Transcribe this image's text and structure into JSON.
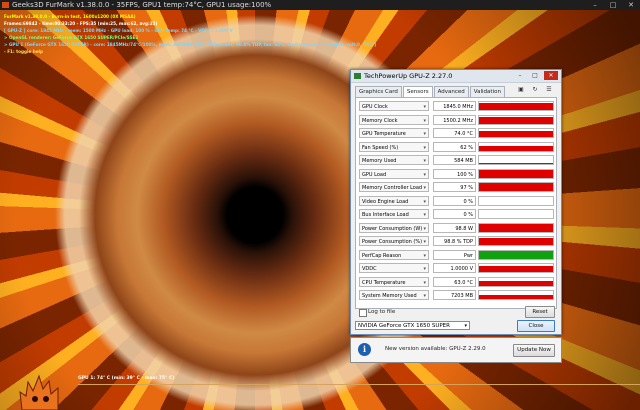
{
  "window": {
    "title": "Geeks3D FurMark v1.38.0.0 - 35FPS, GPU1 temp:74°C, GPU1 usage:100%",
    "minimize": "–",
    "maximize": "□",
    "close": "✕"
  },
  "osd": [
    "FurMark v1.38.0.0 - Burn-in test, 1600x1200 (0X MSAA)",
    "Frames:69842 - time:00:33:20 - FPS:35 (min:25, max:62, avg:35)",
    "[ GPU-Z ] core: 1845 MHz - mem: 1500 MHz - GPU load: 100 % - GPU temp: 74 °C - VDDC: 1.000 V",
    "> OpenGL renderer: GeForce GTX 1650 SUPER/PCIe/SSE2",
    "> GPU 1 (GeForce GTX 1650 SUPER) - core: 1845MHz/74°C/100%, mem: 6000MHz/9%, GPU power: 98.8% TDP, fan: 62%, limits:[power:1, temp:0, volt:0, OV:0]",
    "- F1: toggle help"
  ],
  "gpuz": {
    "title": "TechPowerUp GPU-Z 2.27.0",
    "window_buttons": [
      "–",
      "□",
      "✕"
    ],
    "tabs": [
      {
        "label": "Graphics Card",
        "active": false
      },
      {
        "label": "Sensors",
        "active": true
      },
      {
        "label": "Advanced",
        "active": false
      },
      {
        "label": "Validation",
        "active": false
      }
    ],
    "toolbar_icons": [
      "camera-icon",
      "refresh-icon",
      "menu-icon"
    ],
    "sensors": [
      {
        "label": "GPU Clock",
        "value": "1845.0 MHz",
        "fill": 0.85,
        "color": "#e00000"
      },
      {
        "label": "Memory Clock",
        "value": "1500.2 MHz",
        "fill": 0.85,
        "color": "#e00000"
      },
      {
        "label": "GPU Temperature",
        "value": "74.0 °C",
        "fill": 0.75,
        "color": "#e00000"
      },
      {
        "label": "Fan Speed (%)",
        "value": "62 %",
        "fill": 0.62,
        "color": "#e00000"
      },
      {
        "label": "Memory Used",
        "value": "584 MB",
        "fill": 0.12,
        "color": "#e00000"
      },
      {
        "label": "GPU Load",
        "value": "100 %",
        "fill": 1.0,
        "color": "#e00000"
      },
      {
        "label": "Memory Controller Load",
        "value": "97 %",
        "fill": 0.97,
        "color": "#e00000"
      },
      {
        "label": "Video Engine Load",
        "value": "0 %",
        "fill": 0.0,
        "color": "#e00000"
      },
      {
        "label": "Bus Interface Load",
        "value": "0 %",
        "fill": 0.0,
        "color": "#e00000"
      },
      {
        "label": "Power Consumption (W)",
        "value": "98.8 W",
        "fill": 0.9,
        "color": "#e00000"
      },
      {
        "label": "Power Consumption (%)",
        "value": "98.8 % TDP",
        "fill": 0.9,
        "color": "#e00000"
      },
      {
        "label": "PerfCap Reason",
        "value": "Pwr",
        "fill": 1.0,
        "color": "#10a010"
      },
      {
        "label": "VDDC",
        "value": "1.0000 V",
        "fill": 0.7,
        "color": "#e00000"
      },
      {
        "label": "CPU Temperature",
        "value": "63.0 °C",
        "fill": 0.6,
        "color": "#e00000"
      },
      {
        "label": "System Memory Used",
        "value": "7203 MB",
        "fill": 0.45,
        "color": "#e00000"
      }
    ],
    "log_to_file": "Log to file",
    "reset": "Reset",
    "gpu_select": "NVIDIA GeForce GTX 1650 SUPER",
    "close": "Close"
  },
  "notice": {
    "icon": "i",
    "message": "New version available: GPU-Z 2.29.0",
    "button": "Update Now"
  },
  "graph": {
    "label": "GPU 1: 74° C (min: 39° C - max: 75° C)"
  }
}
